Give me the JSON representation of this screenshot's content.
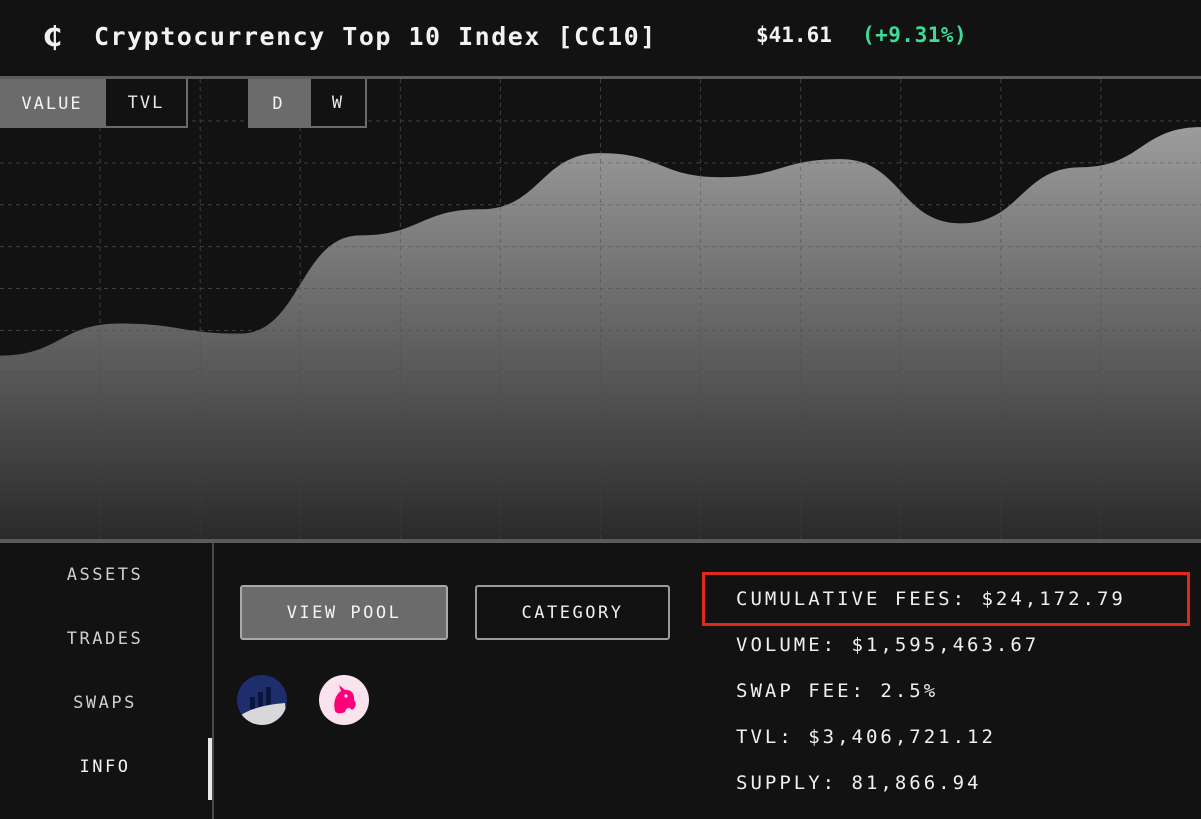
{
  "header": {
    "logo_glyph": "₵",
    "title": "Cryptocurrency Top 10 Index [CC10]",
    "price": "$41.61",
    "change": "(+9.31%)",
    "change_color": "#3ddc97"
  },
  "chart_controls": {
    "metric": {
      "options": [
        "VALUE",
        "TVL"
      ],
      "selected": "VALUE"
    },
    "range": {
      "options": [
        "D",
        "W"
      ],
      "selected": "D"
    }
  },
  "chart_data": {
    "type": "area",
    "series": [
      {
        "values": [
          36.2,
          37.8,
          37.3,
          42.2,
          43.5,
          46.3,
          45.1,
          46.0,
          42.8,
          45.6,
          47.6
        ]
      }
    ],
    "fill_color": "#9a9a9a",
    "grid": true
  },
  "sidebar": {
    "items": [
      {
        "label": "ASSETS"
      },
      {
        "label": "TRADES"
      },
      {
        "label": "SWAPS"
      },
      {
        "label": "INFO"
      }
    ],
    "selected": "INFO"
  },
  "actions": {
    "view_pool": "VIEW POOL",
    "category": "CATEGORY"
  },
  "protocols": [
    {
      "icon": "balancer-icon"
    },
    {
      "icon": "uniswap-unicorn-icon"
    }
  ],
  "stats": {
    "cumulative_fees": "CUMULATIVE FEES: $24,172.79",
    "volume": "VOLUME: $1,595,463.67",
    "swap_fee": "SWAP FEE: 2.5%",
    "tvl": "TVL: $3,406,721.12",
    "supply": "SUPPLY: 81,866.94"
  },
  "highlight_color": "#e0281c"
}
